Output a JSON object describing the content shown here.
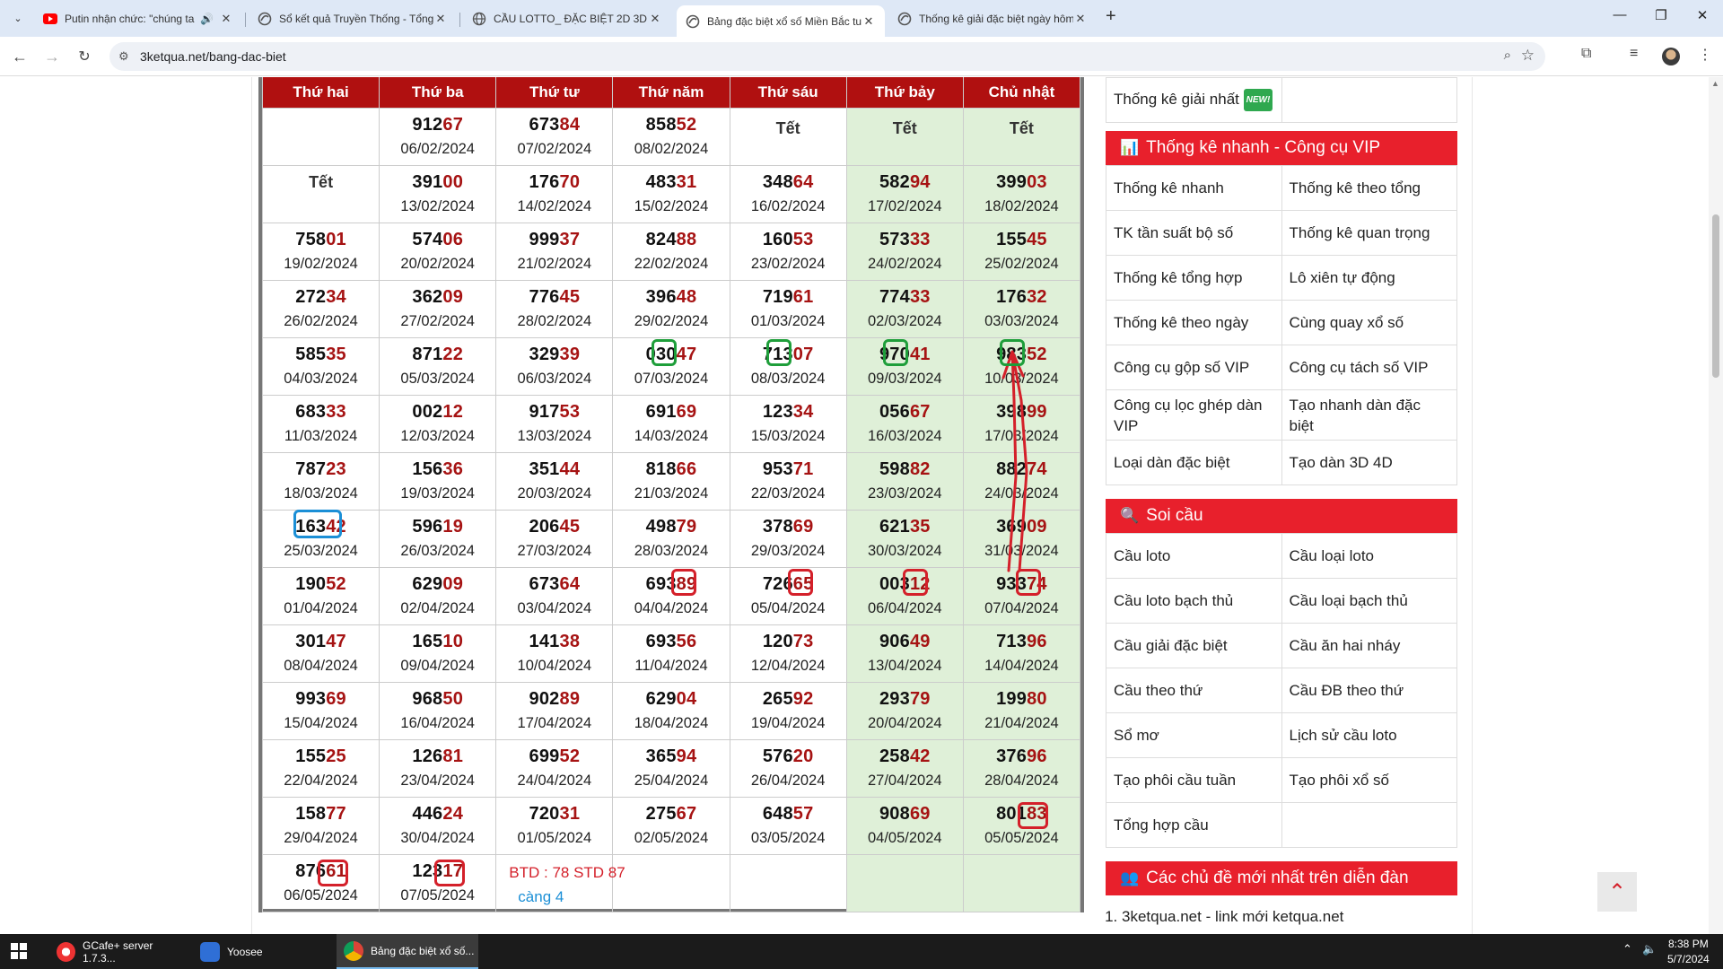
{
  "browser": {
    "tabs": [
      {
        "title": "Putin nhận chức: \"chúng ta",
        "icon": "youtube-icon",
        "audio": true
      },
      {
        "title": "Sổ kết quả Truyền Thống - Tổng",
        "icon": "site-icon"
      },
      {
        "title": "CẦU LOTTO_ ĐẶC BIỆT 2D 3D 4",
        "icon": "globe-icon"
      },
      {
        "title": "Bảng đặc biệt xổ số Miền Bắc tu",
        "icon": "site-icon",
        "active": true
      },
      {
        "title": "Thống kê giải đặc biệt ngày hôm",
        "icon": "site-icon"
      }
    ],
    "url": "3ketqua.net/bang-dac-biet"
  },
  "lotto": {
    "headers": [
      "Thứ hai",
      "Thứ ba",
      "Thứ tư",
      "Thứ năm",
      "Thứ sáu",
      "Thứ bảy",
      "Chủ nhật"
    ],
    "rows": [
      [
        {
          "tet": "",
          "empty": true
        },
        {
          "h": "912",
          "t": "67",
          "d": "06/02/2024"
        },
        {
          "h": "673",
          "t": "84",
          "d": "07/02/2024"
        },
        {
          "h": "858",
          "t": "52",
          "d": "08/02/2024"
        },
        {
          "tet": "Tết"
        },
        {
          "tet": "Tết"
        },
        {
          "tet": "Tết"
        }
      ],
      [
        {
          "tet": "Tết"
        },
        {
          "h": "391",
          "t": "00",
          "d": "13/02/2024"
        },
        {
          "h": "176",
          "t": "70",
          "d": "14/02/2024"
        },
        {
          "h": "483",
          "t": "31",
          "d": "15/02/2024"
        },
        {
          "h": "348",
          "t": "64",
          "d": "16/02/2024"
        },
        {
          "h": "582",
          "t": "94",
          "d": "17/02/2024"
        },
        {
          "h": "399",
          "t": "03",
          "d": "18/02/2024"
        }
      ],
      [
        {
          "h": "758",
          "t": "01",
          "d": "19/02/2024"
        },
        {
          "h": "574",
          "t": "06",
          "d": "20/02/2024"
        },
        {
          "h": "999",
          "t": "37",
          "d": "21/02/2024"
        },
        {
          "h": "824",
          "t": "88",
          "d": "22/02/2024"
        },
        {
          "h": "160",
          "t": "53",
          "d": "23/02/2024"
        },
        {
          "h": "573",
          "t": "33",
          "d": "24/02/2024"
        },
        {
          "h": "155",
          "t": "45",
          "d": "25/02/2024"
        }
      ],
      [
        {
          "h": "272",
          "t": "34",
          "d": "26/02/2024"
        },
        {
          "h": "362",
          "t": "09",
          "d": "27/02/2024"
        },
        {
          "h": "776",
          "t": "45",
          "d": "28/02/2024"
        },
        {
          "h": "396",
          "t": "48",
          "d": "29/02/2024"
        },
        {
          "h": "719",
          "t": "61",
          "d": "01/03/2024"
        },
        {
          "h": "774",
          "t": "33",
          "d": "02/03/2024"
        },
        {
          "h": "176",
          "t": "32",
          "d": "03/03/2024"
        }
      ],
      [
        {
          "h": "585",
          "t": "35",
          "d": "04/03/2024"
        },
        {
          "h": "871",
          "t": "22",
          "d": "05/03/2024"
        },
        {
          "h": "329",
          "t": "39",
          "d": "06/03/2024"
        },
        {
          "h": "030",
          "t": "47",
          "d": "07/03/2024"
        },
        {
          "h": "713",
          "t": "07",
          "d": "08/03/2024"
        },
        {
          "h": "970",
          "t": "41",
          "d": "09/03/2024"
        },
        {
          "h": "983",
          "t": "52",
          "d": "10/03/2024"
        }
      ],
      [
        {
          "h": "683",
          "t": "33",
          "d": "11/03/2024"
        },
        {
          "h": "002",
          "t": "12",
          "d": "12/03/2024"
        },
        {
          "h": "917",
          "t": "53",
          "d": "13/03/2024"
        },
        {
          "h": "691",
          "t": "69",
          "d": "14/03/2024"
        },
        {
          "h": "123",
          "t": "34",
          "d": "15/03/2024"
        },
        {
          "h": "056",
          "t": "67",
          "d": "16/03/2024"
        },
        {
          "h": "398",
          "t": "99",
          "d": "17/03/2024"
        }
      ],
      [
        {
          "h": "787",
          "t": "23",
          "d": "18/03/2024"
        },
        {
          "h": "156",
          "t": "36",
          "d": "19/03/2024"
        },
        {
          "h": "351",
          "t": "44",
          "d": "20/03/2024"
        },
        {
          "h": "818",
          "t": "66",
          "d": "21/03/2024"
        },
        {
          "h": "953",
          "t": "71",
          "d": "22/03/2024"
        },
        {
          "h": "598",
          "t": "82",
          "d": "23/03/2024"
        },
        {
          "h": "882",
          "t": "74",
          "d": "24/03/2024"
        }
      ],
      [
        {
          "h": "163",
          "t": "42",
          "d": "25/03/2024"
        },
        {
          "h": "596",
          "t": "19",
          "d": "26/03/2024"
        },
        {
          "h": "206",
          "t": "45",
          "d": "27/03/2024"
        },
        {
          "h": "498",
          "t": "79",
          "d": "28/03/2024"
        },
        {
          "h": "378",
          "t": "69",
          "d": "29/03/2024"
        },
        {
          "h": "621",
          "t": "35",
          "d": "30/03/2024"
        },
        {
          "h": "369",
          "t": "09",
          "d": "31/03/2024"
        }
      ],
      [
        {
          "h": "190",
          "t": "52",
          "d": "01/04/2024"
        },
        {
          "h": "629",
          "t": "09",
          "d": "02/04/2024"
        },
        {
          "h": "673",
          "t": "64",
          "d": "03/04/2024"
        },
        {
          "h": "693",
          "t": "89",
          "d": "04/04/2024"
        },
        {
          "h": "726",
          "t": "65",
          "d": "05/04/2024"
        },
        {
          "h": "003",
          "t": "12",
          "d": "06/04/2024"
        },
        {
          "h": "933",
          "t": "74",
          "d": "07/04/2024"
        }
      ],
      [
        {
          "h": "301",
          "t": "47",
          "d": "08/04/2024"
        },
        {
          "h": "165",
          "t": "10",
          "d": "09/04/2024"
        },
        {
          "h": "141",
          "t": "38",
          "d": "10/04/2024"
        },
        {
          "h": "693",
          "t": "56",
          "d": "11/04/2024"
        },
        {
          "h": "120",
          "t": "73",
          "d": "12/04/2024"
        },
        {
          "h": "906",
          "t": "49",
          "d": "13/04/2024"
        },
        {
          "h": "713",
          "t": "96",
          "d": "14/04/2024"
        }
      ],
      [
        {
          "h": "993",
          "t": "69",
          "d": "15/04/2024"
        },
        {
          "h": "968",
          "t": "50",
          "d": "16/04/2024"
        },
        {
          "h": "902",
          "t": "89",
          "d": "17/04/2024"
        },
        {
          "h": "629",
          "t": "04",
          "d": "18/04/2024"
        },
        {
          "h": "265",
          "t": "92",
          "d": "19/04/2024"
        },
        {
          "h": "293",
          "t": "79",
          "d": "20/04/2024"
        },
        {
          "h": "199",
          "t": "80",
          "d": "21/04/2024"
        }
      ],
      [
        {
          "h": "155",
          "t": "25",
          "d": "22/04/2024"
        },
        {
          "h": "126",
          "t": "81",
          "d": "23/04/2024"
        },
        {
          "h": "699",
          "t": "52",
          "d": "24/04/2024"
        },
        {
          "h": "365",
          "t": "94",
          "d": "25/04/2024"
        },
        {
          "h": "576",
          "t": "20",
          "d": "26/04/2024"
        },
        {
          "h": "258",
          "t": "42",
          "d": "27/04/2024"
        },
        {
          "h": "376",
          "t": "96",
          "d": "28/04/2024"
        }
      ],
      [
        {
          "h": "158",
          "t": "77",
          "d": "29/04/2024"
        },
        {
          "h": "446",
          "t": "24",
          "d": "30/04/2024"
        },
        {
          "h": "720",
          "t": "31",
          "d": "01/05/2024"
        },
        {
          "h": "275",
          "t": "67",
          "d": "02/05/2024"
        },
        {
          "h": "648",
          "t": "57",
          "d": "03/05/2024"
        },
        {
          "h": "908",
          "t": "69",
          "d": "04/05/2024"
        },
        {
          "h": "801",
          "t": "83",
          "d": "05/05/2024"
        }
      ],
      [
        {
          "h": "876",
          "t": "61",
          "d": "06/05/2024"
        },
        {
          "h": "123",
          "t": "17",
          "d": "07/05/2024"
        },
        {
          "btd": "BTD : 78 STD 87",
          "cang": "càng 4"
        },
        {
          "empty": true
        },
        {
          "empty": true
        },
        {
          "empty": true
        },
        {
          "empty": true
        }
      ]
    ]
  },
  "sidebar": {
    "top_row": {
      "left": "Thống kê giải nhất",
      "badge": "NEW!"
    },
    "vip_title": "Thống kê nhanh - Công cụ VIP",
    "vip_items": [
      [
        "Thống kê nhanh",
        "Thống kê theo tổng"
      ],
      [
        "TK tần suất bộ số",
        "Thống kê quan trọng"
      ],
      [
        "Thống kê tổng hợp",
        "Lô xiên tự động"
      ],
      [
        "Thống kê theo ngày",
        "Cùng quay xổ số"
      ],
      [
        "Công cụ gộp số VIP",
        "Công cụ tách số VIP"
      ],
      [
        "Công cụ lọc ghép dàn VIP",
        "Tạo nhanh dàn đặc biệt"
      ],
      [
        "Loại dàn đặc biệt",
        "Tạo dàn 3D 4D"
      ]
    ],
    "soi_title": "Soi cầu",
    "soi_items": [
      [
        "Cầu loto",
        "Cầu loại loto"
      ],
      [
        "Cầu loto bạch thủ",
        "Cầu loại bạch thủ"
      ],
      [
        "Cầu giải đặc biệt",
        "Cầu ăn hai nháy"
      ],
      [
        "Cầu theo thứ",
        "Cầu ĐB theo thứ"
      ],
      [
        "Sổ mơ",
        "Lịch sử cầu loto"
      ],
      [
        "Tạo phôi cầu tuần",
        "Tạo phôi xổ số"
      ],
      [
        "Tổng hợp cầu",
        ""
      ]
    ],
    "forum_title": "Các chủ đề mới nhất trên diễn đàn",
    "forum_items": [
      "3ketqua.net - link mới ketqua.net"
    ]
  },
  "taskbar": {
    "apps": [
      "GCafe+ server 1.7.3...",
      "Yoosee",
      "Bảng đặc biệt xổ số..."
    ],
    "time": "8:38 PM",
    "date": "5/7/2024"
  },
  "colors": {
    "header_red": "#b01010",
    "tail_red": "#a61313",
    "side_red": "#e8202c",
    "weekend_green": "#dff0d8",
    "mark_green": "#1e9e3a",
    "mark_red": "#d4202a",
    "mark_blue": "#1b8fd6"
  }
}
